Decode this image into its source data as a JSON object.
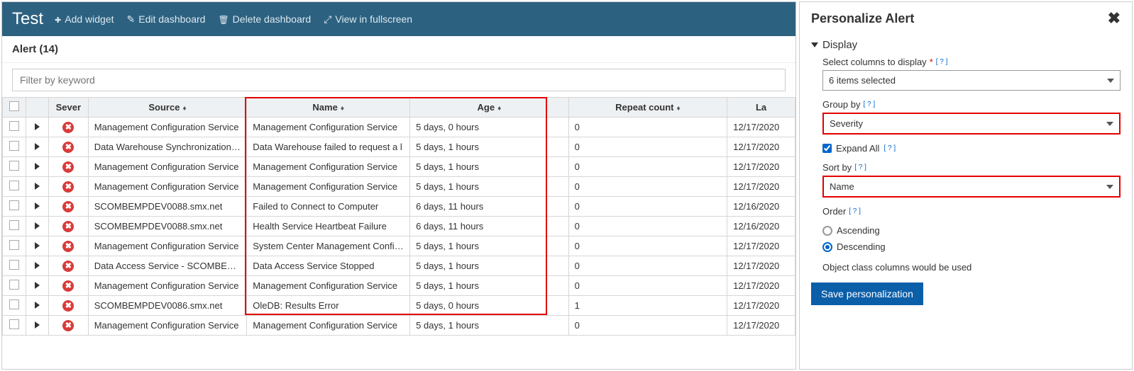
{
  "topbar": {
    "title": "Test",
    "add_widget": "Add widget",
    "edit_dashboard": "Edit dashboard",
    "delete_dashboard": "Delete dashboard",
    "fullscreen": "View in fullscreen"
  },
  "alert_header": "Alert (14)",
  "filter_placeholder": "Filter by keyword",
  "columns": {
    "severity": "Sever",
    "source": "Source",
    "name": "Name",
    "age": "Age",
    "repeat": "Repeat count",
    "last": "La"
  },
  "rows": [
    {
      "source": "Management Configuration Service",
      "name": "Management Configuration Service",
      "age": "5 days, 0 hours",
      "repeat": "0",
      "last": "12/17/2020"
    },
    {
      "source": "Data Warehouse Synchronization Se",
      "name": "Data Warehouse failed to request a l",
      "age": "5 days, 1 hours",
      "repeat": "0",
      "last": "12/17/2020"
    },
    {
      "source": "Management Configuration Service",
      "name": "Management Configuration Service",
      "age": "5 days, 1 hours",
      "repeat": "0",
      "last": "12/17/2020"
    },
    {
      "source": "Management Configuration Service",
      "name": "Management Configuration Service",
      "age": "5 days, 1 hours",
      "repeat": "0",
      "last": "12/17/2020"
    },
    {
      "source": "SCOMBEMPDEV0088.smx.net",
      "name": "Failed to Connect to Computer",
      "age": "6 days, 11 hours",
      "repeat": "0",
      "last": "12/16/2020"
    },
    {
      "source": "SCOMBEMPDEV0088.smx.net",
      "name": "Health Service Heartbeat Failure",
      "age": "6 days, 11 hours",
      "repeat": "0",
      "last": "12/16/2020"
    },
    {
      "source": "Management Configuration Service",
      "name": "System Center Management Configu",
      "age": "5 days, 1 hours",
      "repeat": "0",
      "last": "12/17/2020"
    },
    {
      "source": "Data Access Service - SCOMBEMPDE",
      "name": "Data Access Service Stopped",
      "age": "5 days, 1 hours",
      "repeat": "0",
      "last": "12/17/2020"
    },
    {
      "source": "Management Configuration Service",
      "name": "Management Configuration Service",
      "age": "5 days, 1 hours",
      "repeat": "0",
      "last": "12/17/2020"
    },
    {
      "source": "SCOMBEMPDEV0086.smx.net",
      "name": "OleDB: Results Error",
      "age": "5 days, 0 hours",
      "repeat": "1",
      "last": "12/17/2020"
    },
    {
      "source": "Management Configuration Service",
      "name": "Management Configuration Service",
      "age": "5 days, 1 hours",
      "repeat": "0",
      "last": "12/17/2020"
    }
  ],
  "panel": {
    "title": "Personalize Alert",
    "display_section": "Display",
    "columns_label": "Select columns to display",
    "columns_value": "6 items selected",
    "group_by_label": "Group by",
    "group_by_value": "Severity",
    "expand_all": "Expand All",
    "sort_by_label": "Sort by",
    "sort_by_value": "Name",
    "order_label": "Order",
    "order_asc": "Ascending",
    "order_desc": "Descending",
    "note": "Object class columns would be used",
    "save": "Save personalization",
    "help": "[ ? ]"
  }
}
